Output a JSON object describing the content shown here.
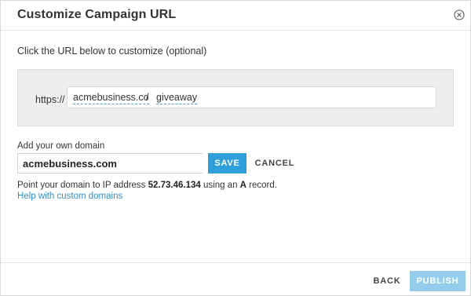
{
  "dialog": {
    "title": "Customize Campaign URL",
    "close_icon": "close-circle-icon"
  },
  "intro_text": "Click the URL below to customize (optional)",
  "url_editor": {
    "prefix": "https://",
    "domain": "acmebusiness.co",
    "separator": "/",
    "path": "giveaway"
  },
  "custom_domain": {
    "label": "Add your own domain",
    "value": "acmebusiness.com",
    "save_label": "SAVE",
    "cancel_label": "CANCEL",
    "instruction_pre": "Point your domain to IP address ",
    "ip_address": "52.73.46.134",
    "instruction_mid": " using an ",
    "record_type": "A",
    "instruction_post": " record.",
    "help_link": "Help with custom domains"
  },
  "footer": {
    "back_label": "BACK",
    "publish_label": "PUBLISH"
  },
  "colors": {
    "accent": "#2e9fd8",
    "publish_disabled": "#94cdeb",
    "link": "#2e90cc",
    "url_box_bg": "#eeeeee"
  }
}
